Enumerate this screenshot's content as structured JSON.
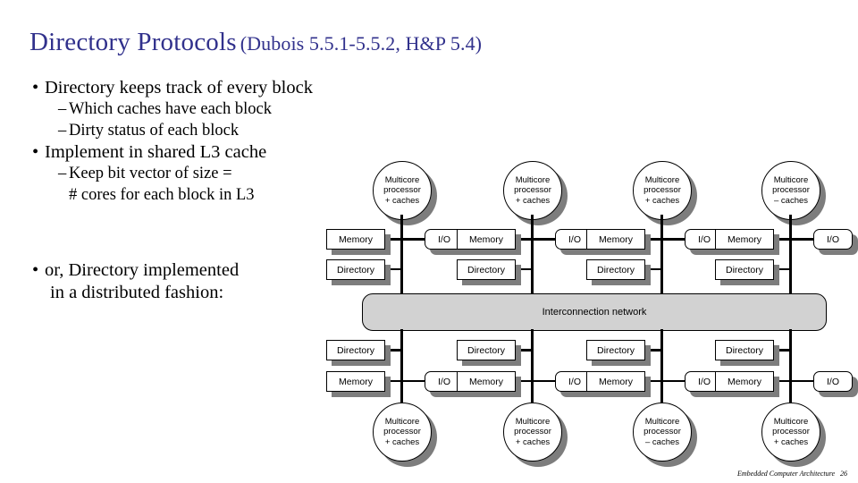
{
  "slide": {
    "title_main": "Directory Protocols",
    "title_sub": "(Dubois 5.5.1-5.5.2, H&P 5.4)",
    "title_color": "#31318c",
    "background": "#ffffff"
  },
  "bullets": {
    "group1": [
      {
        "marker": "•",
        "text": "Directory keeps track of every block",
        "level": 1
      },
      {
        "marker": "–",
        "text": "Which caches have each block",
        "level": 2
      },
      {
        "marker": "–",
        "text": "Dirty status of each block",
        "level": 2
      },
      {
        "marker": "•",
        "text": "Implement in shared L3 cache",
        "level": 1
      },
      {
        "marker": "–",
        "text": "Keep bit vector of size =",
        "level": 2
      },
      {
        "marker": "",
        "text": "# cores for each block in L3",
        "level": 2
      }
    ],
    "group2": [
      {
        "marker": "•",
        "text": "or, Directory implemented",
        "level": 1
      },
      {
        "marker": "",
        "text": "in a distributed fashion:",
        "level": 1
      }
    ]
  },
  "diagram": {
    "network_label": "Interconnection network",
    "memory_label": "Memory",
    "directory_label": "Directory",
    "io_label": "I/O",
    "node_line1": "Multicore",
    "node_line2": "processor",
    "shadow_color": "#7d7d7d",
    "network_fill": "#d2d2d2",
    "top_nodes": [
      {
        "cache_line": "+ caches"
      },
      {
        "cache_line": "+ caches"
      },
      {
        "cache_line": "+ caches"
      },
      {
        "cache_line": "– caches"
      }
    ],
    "bottom_nodes": [
      {
        "cache_line": "+ caches"
      },
      {
        "cache_line": "+ caches"
      },
      {
        "cache_line": "– caches"
      },
      {
        "cache_line": "+ caches"
      }
    ]
  },
  "footer": {
    "course": "Embedded Computer Architecture",
    "page": "26"
  }
}
